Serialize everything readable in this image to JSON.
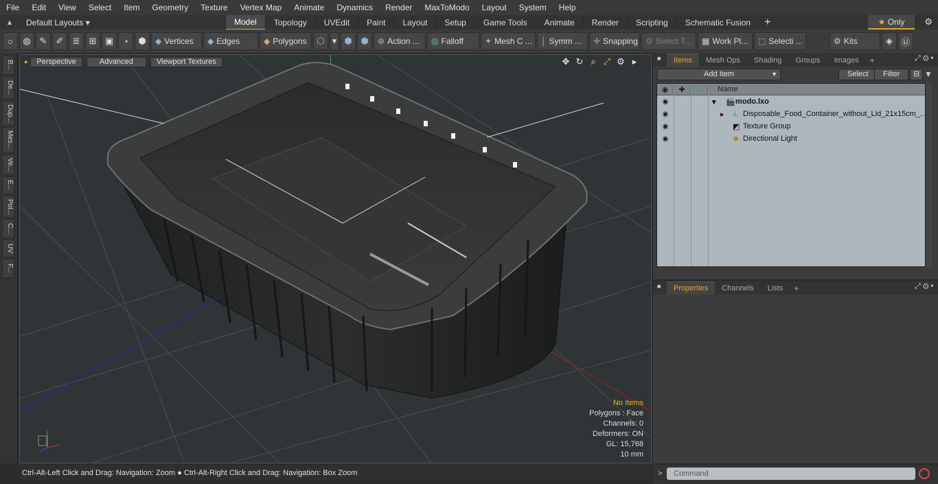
{
  "menu": [
    "File",
    "Edit",
    "View",
    "Select",
    "Item",
    "Geometry",
    "Texture",
    "Vertex Map",
    "Animate",
    "Dynamics",
    "Render",
    "MaxToModo",
    "Layout",
    "System",
    "Help"
  ],
  "layouts": {
    "current": "Default Layouts ▾",
    "tabs": [
      "Model",
      "Topology",
      "UVEdit",
      "Paint",
      "Layout",
      "Setup",
      "Game Tools",
      "Animate",
      "Render",
      "Scripting",
      "Schematic Fusion"
    ],
    "active": "Model",
    "only_label": "Only"
  },
  "toolbar": {
    "vertices": "Vertices",
    "edges": "Edges",
    "polygons": "Polygons",
    "action": "Action ...",
    "falloff": "Falloff",
    "mesh": "Mesh C ...",
    "symm": "Symm ...",
    "snapping": "Snapping",
    "select_t": "Select T...",
    "work_pl": "Work Pl...",
    "selecti": "Selecti ...",
    "kits": "Kits"
  },
  "left_tabs": [
    "B...",
    "De...",
    "Dup...",
    "Mes...",
    "Ve...",
    "E...",
    "Pol...",
    "C...",
    "UV",
    "F..."
  ],
  "viewport": {
    "perspective": "Perspective",
    "advanced": "Advanced",
    "viewport_textures": "Viewport Textures",
    "info": {
      "no_items": "No Items",
      "polygons": "Polygons : Face",
      "channels": "Channels: 0",
      "deformers": "Deformers: ON",
      "gl": "GL: 15,768",
      "scale": "10 mm"
    }
  },
  "status_text": "Ctrl-Alt-Left Click and Drag: Navigation: Zoom ● Ctrl-Alt-Right Click and Drag: Navigation: Box Zoom",
  "items_panel": {
    "tabs": [
      "Items",
      "Mesh Ops",
      "Shading",
      "Groups",
      "Images"
    ],
    "active_tab": "Items",
    "add_item": "Add Item",
    "select": "Select",
    "filter": "Filter",
    "column_name": "Name",
    "tree": [
      {
        "label": "modo.lxo",
        "indent": 0
      },
      {
        "label": "Disposable_Food_Container_without_Lid_21x15cm_...",
        "indent": 1
      },
      {
        "label": "Texture Group",
        "indent": 1
      },
      {
        "label": "Directional Light",
        "indent": 1
      }
    ]
  },
  "properties_panel": {
    "tabs": [
      "Properties",
      "Channels",
      "Lists"
    ],
    "active_tab": "Properties"
  },
  "command": {
    "placeholder": "Command"
  }
}
